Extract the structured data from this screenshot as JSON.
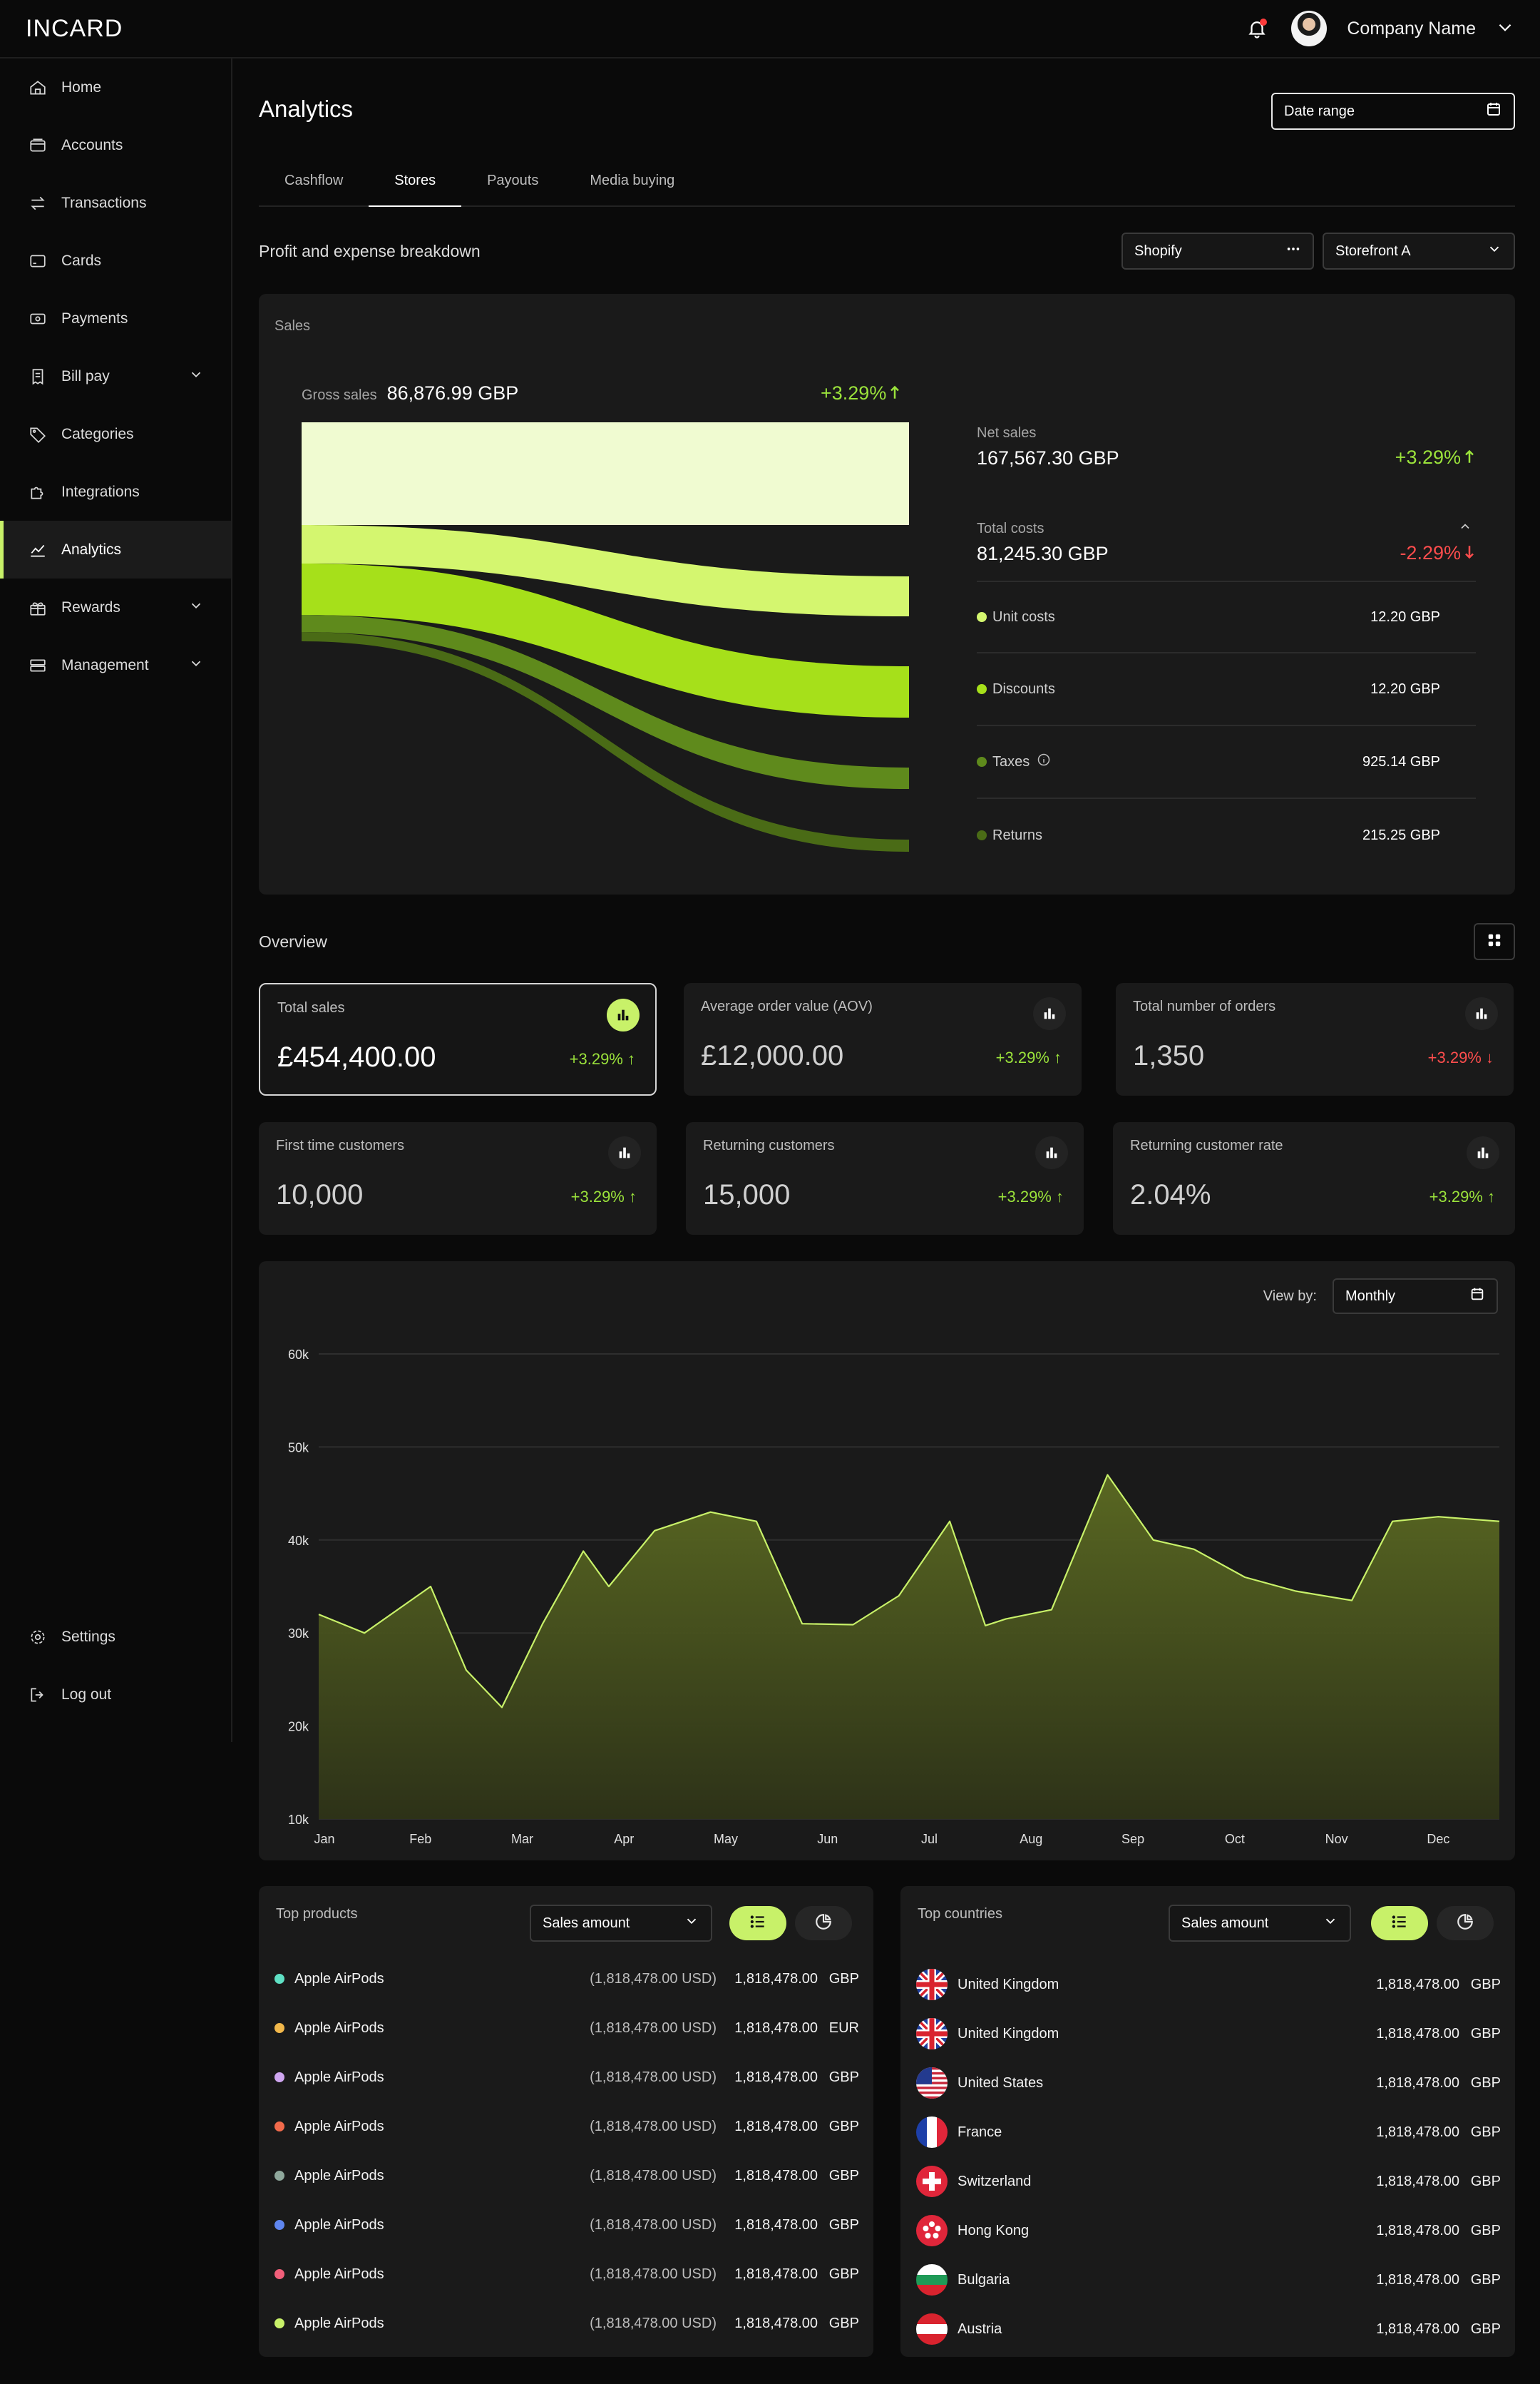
{
  "app": {
    "logo": "INCARD",
    "company": "Company Name"
  },
  "sidebar": {
    "items": [
      {
        "label": "Home",
        "icon": "home-icon"
      },
      {
        "label": "Accounts",
        "icon": "wallet-icon"
      },
      {
        "label": "Transactions",
        "icon": "transfer-icon"
      },
      {
        "label": "Cards",
        "icon": "card-icon"
      },
      {
        "label": "Payments",
        "icon": "payments-icon"
      },
      {
        "label": "Bill pay",
        "icon": "bill-icon"
      },
      {
        "label": "Categories",
        "icon": "tag-icon"
      },
      {
        "label": "Integrations",
        "icon": "puzzle-icon"
      },
      {
        "label": "Analytics",
        "icon": "analytics-icon"
      },
      {
        "label": "Rewards",
        "icon": "gift-icon"
      },
      {
        "label": "Management",
        "icon": "management-icon"
      }
    ],
    "bottom": [
      {
        "label": "Settings",
        "icon": "gear-icon"
      },
      {
        "label": "Log out",
        "icon": "logout-icon"
      }
    ]
  },
  "page": {
    "title": "Analytics",
    "date_range": "Date range",
    "tabs": [
      "Cashflow",
      "Stores",
      "Payouts",
      "Media buying"
    ],
    "active_tab": "Stores"
  },
  "breakdown": {
    "title": "Profit and expense breakdown",
    "platform": "Shopify",
    "store": "Storefront A",
    "sales_label": "Sales",
    "gross_label": "Gross sales",
    "gross_value": "86,876.99 GBP",
    "gross_change": "+3.29%",
    "net_label": "Net sales",
    "net_value": "167,567.30 GBP",
    "net_change": "+3.29%",
    "costs_label": "Total costs",
    "costs_value": "81,245.30 GBP",
    "costs_change": "-2.29%",
    "items": [
      {
        "label": "Unit costs",
        "value": "12.20 GBP",
        "color": "#d4f66f"
      },
      {
        "label": "Discounts",
        "value": "12.20 GBP",
        "color": "#a6e01a"
      },
      {
        "label": "Taxes",
        "value": "925.14 GBP",
        "color": "#5f8a1c"
      },
      {
        "label": "Returns",
        "value": "215.25 GBP",
        "color": "#4a6b16"
      }
    ]
  },
  "overview": {
    "title": "Overview",
    "kpis": [
      {
        "label": "Total sales",
        "value": "£454,400.00",
        "change": "+3.29%",
        "dir": "up"
      },
      {
        "label": "Average order value (AOV)",
        "value": "£12,000.00",
        "change": "+3.29%",
        "dir": "up"
      },
      {
        "label": "Total number of orders",
        "value": "1,350",
        "change": "+3.29%",
        "dir": "down"
      },
      {
        "label": "First time customers",
        "value": "10,000",
        "change": "+3.29%",
        "dir": "up"
      },
      {
        "label": "Returning customers",
        "value": "15,000",
        "change": "+3.29%",
        "dir": "up"
      },
      {
        "label": "Returning customer rate",
        "value": "2.04%",
        "change": "+3.29%",
        "dir": "up"
      }
    ]
  },
  "chart_controls": {
    "view_by_label": "View by:",
    "view_by_value": "Monthly"
  },
  "chart_data": {
    "type": "area",
    "ylim": [
      10000,
      60000
    ],
    "yticks": [
      "10k",
      "20k",
      "30k",
      "40k",
      "50k",
      "60k"
    ],
    "ytick_values": [
      10000,
      20000,
      30000,
      40000,
      50000,
      60000
    ],
    "xticks": [
      "Jan",
      "Feb",
      "Mar",
      "Apr",
      "May",
      "Jun",
      "Jul",
      "Aug",
      "Sep",
      "Oct",
      "Nov",
      "Dec"
    ],
    "x": [
      0,
      0.45,
      1.1,
      1.45,
      1.8,
      2.2,
      2.6,
      2.85,
      3.3,
      3.85,
      4.3,
      4.75,
      5.25,
      5.7,
      6.2,
      6.55,
      6.75,
      7.2,
      7.75,
      8.2,
      8.6,
      9.1,
      9.6,
      10.15,
      10.55,
      11,
      11.6
    ],
    "values": [
      32000,
      30000,
      35000,
      26000,
      22000,
      31000,
      38800,
      35000,
      41000,
      43000,
      42000,
      31000,
      30900,
      34000,
      42000,
      30800,
      31500,
      32500,
      47000,
      40000,
      39000,
      36000,
      34500,
      33500,
      42000,
      42500,
      42000
    ]
  },
  "top_products": {
    "title": "Top products",
    "select": "Sales amount",
    "rows": [
      {
        "name": "Apple AirPods",
        "usd": "(1,818,478.00 USD)",
        "amount": "1,818,478.00",
        "currency": "GBP",
        "color": "#5fe0c4"
      },
      {
        "name": "Apple AirPods",
        "usd": "(1,818,478.00 USD)",
        "amount": "1,818,478.00",
        "currency": "EUR",
        "color": "#f2b84b"
      },
      {
        "name": "Apple AirPods",
        "usd": "(1,818,478.00 USD)",
        "amount": "1,818,478.00",
        "currency": "GBP",
        "color": "#cfa6f0"
      },
      {
        "name": "Apple AirPods",
        "usd": "(1,818,478.00 USD)",
        "amount": "1,818,478.00",
        "currency": "GBP",
        "color": "#f26a4b"
      },
      {
        "name": "Apple AirPods",
        "usd": "(1,818,478.00 USD)",
        "amount": "1,818,478.00",
        "currency": "GBP",
        "color": "#8fa89c"
      },
      {
        "name": "Apple AirPods",
        "usd": "(1,818,478.00 USD)",
        "amount": "1,818,478.00",
        "currency": "GBP",
        "color": "#5f86f0"
      },
      {
        "name": "Apple AirPods",
        "usd": "(1,818,478.00 USD)",
        "amount": "1,818,478.00",
        "currency": "GBP",
        "color": "#f25f7a"
      },
      {
        "name": "Apple AirPods",
        "usd": "(1,818,478.00 USD)",
        "amount": "1,818,478.00",
        "currency": "GBP",
        "color": "#c8f169"
      }
    ]
  },
  "top_countries": {
    "title": "Top countries",
    "select": "Sales amount",
    "rows": [
      {
        "name": "United Kingdom",
        "flag": "uk-flag-icon",
        "amount": "1,818,478.00",
        "currency": "GBP"
      },
      {
        "name": "United Kingdom",
        "flag": "uk-flag-icon",
        "amount": "1,818,478.00",
        "currency": "GBP"
      },
      {
        "name": "United States",
        "flag": "us-flag-icon",
        "amount": "1,818,478.00",
        "currency": "GBP"
      },
      {
        "name": "France",
        "flag": "france-flag-icon",
        "amount": "1,818,478.00",
        "currency": "GBP"
      },
      {
        "name": "Switzerland",
        "flag": "switzerland-flag-icon",
        "amount": "1,818,478.00",
        "currency": "GBP"
      },
      {
        "name": "Hong Kong",
        "flag": "hong-kong-flag-icon",
        "amount": "1,818,478.00",
        "currency": "GBP"
      },
      {
        "name": "Bulgaria",
        "flag": "bulgaria-flag-icon",
        "amount": "1,818,478.00",
        "currency": "GBP"
      },
      {
        "name": "Austria",
        "flag": "austria-flag-icon",
        "amount": "1,818,478.00",
        "currency": "GBP"
      }
    ]
  },
  "colors": {
    "accent": "#c8f169",
    "positive": "#9be33b",
    "negative": "#ff4d4d",
    "card": "#1a1a1a",
    "background": "#0a0a0a"
  }
}
